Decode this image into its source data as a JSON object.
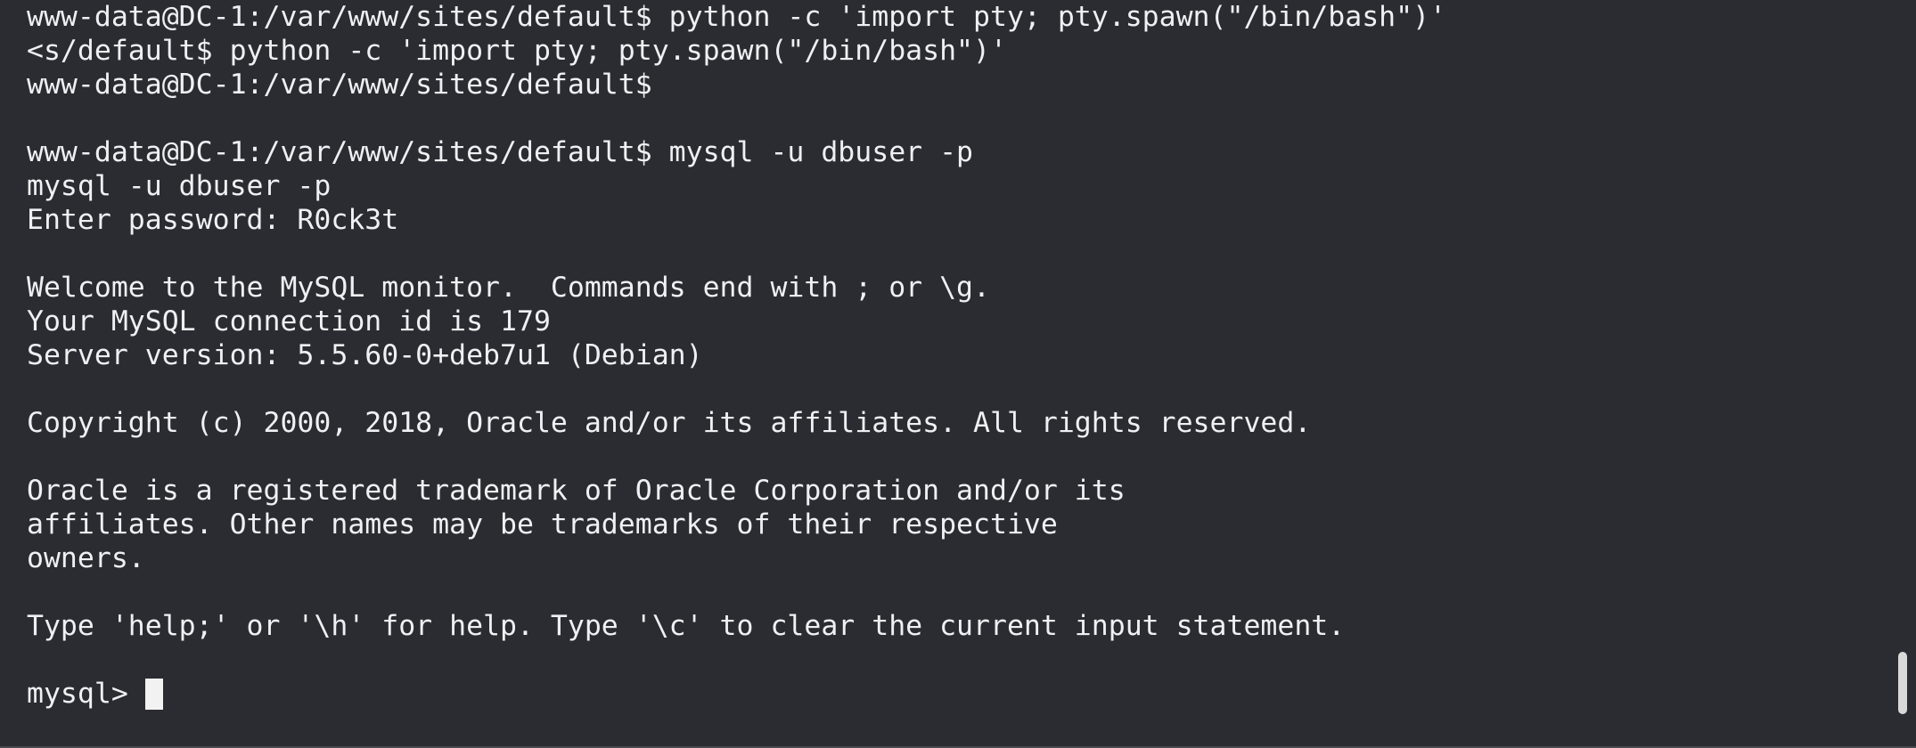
{
  "terminal": {
    "lines": [
      "www-data@DC-1:/var/www/sites/default$ python -c 'import pty; pty.spawn(\"/bin/bash\")'",
      "<s/default$ python -c 'import pty; pty.spawn(\"/bin/bash\")'",
      "www-data@DC-1:/var/www/sites/default$",
      "",
      "www-data@DC-1:/var/www/sites/default$ mysql -u dbuser -p",
      "mysql -u dbuser -p",
      "Enter password: R0ck3t",
      "",
      "Welcome to the MySQL monitor.  Commands end with ; or \\g.",
      "Your MySQL connection id is 179",
      "Server version: 5.5.60-0+deb7u1 (Debian)",
      "",
      "Copyright (c) 2000, 2018, Oracle and/or its affiliates. All rights reserved.",
      "",
      "Oracle is a registered trademark of Oracle Corporation and/or its",
      "affiliates. Other names may be trademarks of their respective",
      "owners.",
      "",
      "Type 'help;' or '\\h' for help. Type '\\c' to clear the current input statement.",
      ""
    ],
    "prompt": "mysql>",
    "input_value": ""
  },
  "colors": {
    "background": "#2b2c31",
    "foreground": "#eef0f3",
    "cursor": "#f2f2f2",
    "scrollbar_thumb": "#d9d9d9"
  }
}
